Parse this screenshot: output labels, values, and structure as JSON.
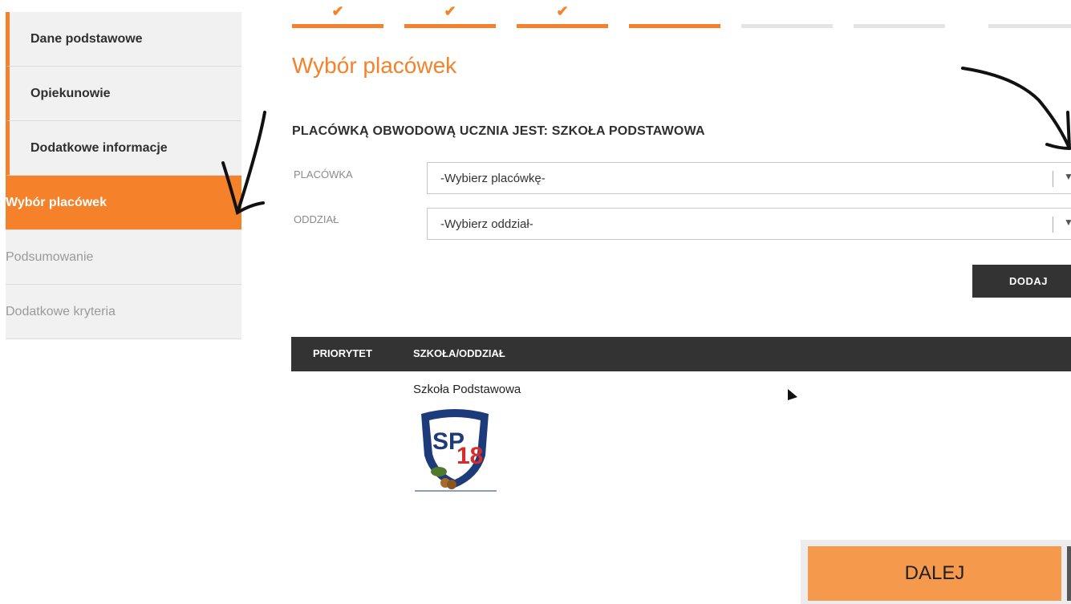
{
  "sidebar": {
    "items": [
      {
        "label": "Dane podstawowe"
      },
      {
        "label": "Opiekunowie"
      },
      {
        "label": "Dodatkowe informacje"
      },
      {
        "label": "Wybór placówek"
      },
      {
        "label": "Podsumowanie"
      },
      {
        "label": "Dodatkowe kryteria"
      }
    ]
  },
  "steps": {
    "check": "✔"
  },
  "page": {
    "title": "Wybór placówek",
    "subtitle": "PLACÓWKĄ OBWODOWĄ UCZNIA JEST: SZKOŁA PODSTAWOWA"
  },
  "form": {
    "placowka_label": "PLACÓWKA",
    "placowka_value": "-Wybierz placówkę-",
    "oddzial_label": "ODDZIAŁ",
    "oddzial_value": "-Wybierz oddział-",
    "add_button": "DODAJ"
  },
  "table": {
    "headers": [
      "PRIORYTET",
      "SZKOŁA/ODDZIAŁ"
    ],
    "rows": [
      {
        "school": "Szkoła Podstawowa"
      }
    ]
  },
  "logo": {
    "text": "SP18"
  },
  "footer": {
    "next_button": "DALEJ"
  },
  "colors": {
    "accent": "#f5822a",
    "dark": "#333333"
  }
}
